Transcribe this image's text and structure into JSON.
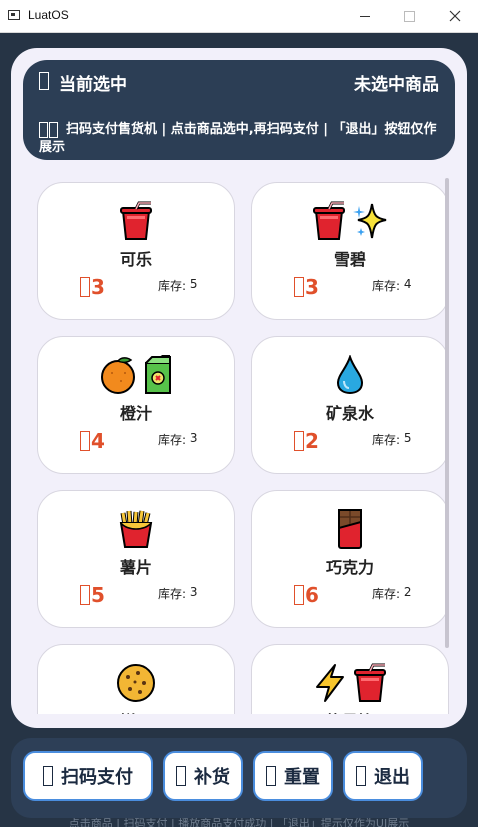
{
  "window": {
    "title": "LuatOS"
  },
  "header": {
    "selected_label": "当前选中",
    "selected_value": "未选中商品",
    "info": "扫码支付售货机 | 点击商品选中,再扫码支付 | 「退出」按钮仅作展示"
  },
  "stock_label": "库存: ",
  "products": [
    {
      "name": "可乐",
      "price": "3",
      "stock": "5",
      "icons": [
        "cup-icon"
      ]
    },
    {
      "name": "雪碧",
      "price": "3",
      "stock": "4",
      "icons": [
        "cup-icon",
        "sparkles-icon"
      ]
    },
    {
      "name": "橙汁",
      "price": "4",
      "stock": "3",
      "icons": [
        "orange-icon",
        "juice-box-icon"
      ]
    },
    {
      "name": "矿泉水",
      "price": "2",
      "stock": "5",
      "icons": [
        "droplet-icon"
      ]
    },
    {
      "name": "薯片",
      "price": "5",
      "stock": "3",
      "icons": [
        "fries-icon"
      ]
    },
    {
      "name": "巧克力",
      "price": "6",
      "stock": "2",
      "icons": [
        "chocolate-icon"
      ]
    },
    {
      "name": "饼干",
      "price": "",
      "stock": "",
      "icons": [
        "cookie-icon"
      ]
    },
    {
      "name": "能量饮",
      "price": "",
      "stock": "",
      "icons": [
        "lightning-icon",
        "cup-icon"
      ]
    }
  ],
  "buttons": {
    "pay": "扫码支付",
    "restock": "补货",
    "reset": "重置",
    "exit": "退出"
  },
  "footer": {
    "text": "点击商品 | 扫码支付 | 播放商品支付成功 | 「退出」提示仅作为UI展示"
  },
  "colors": {
    "header": "#2c3e55",
    "price": "#e0502b",
    "button_border": "#4a8dde",
    "background": "#263445"
  }
}
